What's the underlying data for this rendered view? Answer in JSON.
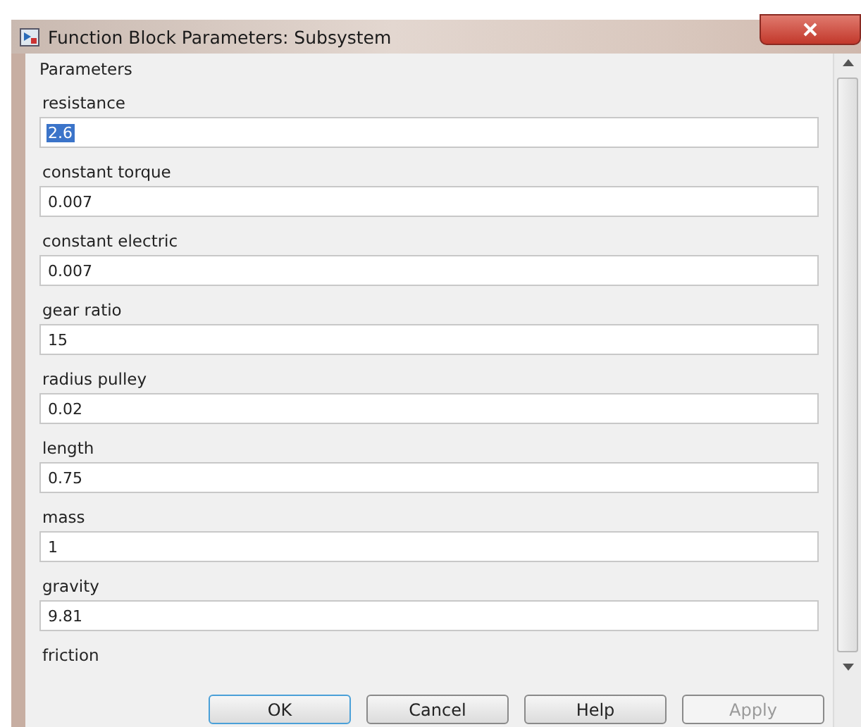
{
  "window": {
    "title": "Function Block Parameters: Subsystem"
  },
  "section": "Parameters",
  "parameters": [
    {
      "label": "resistance",
      "value": "2.6",
      "value_selected": true
    },
    {
      "label": "constant torque",
      "value": "0.007",
      "value_selected": false
    },
    {
      "label": "constant electric",
      "value": "0.007",
      "value_selected": false
    },
    {
      "label": "gear ratio",
      "value": "15",
      "value_selected": false
    },
    {
      "label": "radius pulley",
      "value": "0.02",
      "value_selected": false
    },
    {
      "label": "length",
      "value": "0.75",
      "value_selected": false
    },
    {
      "label": "mass",
      "value": "1",
      "value_selected": false
    },
    {
      "label": "gravity",
      "value": "9.81",
      "value_selected": false
    },
    {
      "label": "friction"
    }
  ],
  "buttons": [
    {
      "label": "OK",
      "disabled": false,
      "default": true
    },
    {
      "label": "Cancel",
      "disabled": false,
      "default": false
    },
    {
      "label": "Help",
      "disabled": false,
      "default": false
    },
    {
      "label": "Apply",
      "disabled": true,
      "default": false
    }
  ]
}
